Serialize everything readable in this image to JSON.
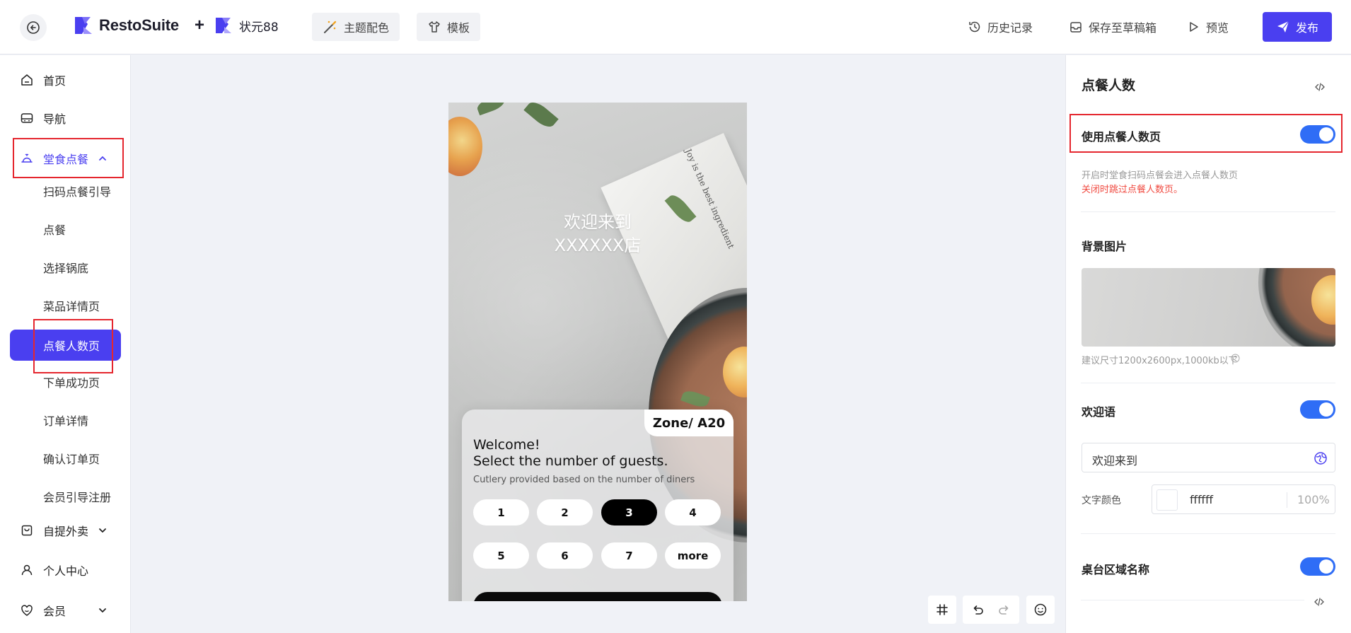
{
  "header": {
    "back_icon": "back-arrow-icon",
    "brand_name": "RestoSuite",
    "plus": "+",
    "store_name": "状元88",
    "theme_btn": "主题配色",
    "template_btn": "模板",
    "history": "历史记录",
    "save_draft": "保存至草稿箱",
    "preview": "预览",
    "publish": "发布",
    "accent_color": "#4a3ff0"
  },
  "sidebar": {
    "items": [
      {
        "label": "首页",
        "icon": "home-icon"
      },
      {
        "label": "导航",
        "icon": "navigation-icon"
      },
      {
        "label": "堂食点餐",
        "icon": "dine-in-icon",
        "expanded": true
      },
      {
        "label": "自提外卖",
        "icon": "takeaway-icon"
      },
      {
        "label": "个人中心",
        "icon": "user-icon"
      },
      {
        "label": "会员",
        "icon": "member-icon"
      }
    ],
    "sub_items": [
      "扫码点餐引导",
      "点餐",
      "选择锅底",
      "菜品详情页",
      "点餐人数页",
      "下单成功页",
      "订单详情",
      "确认订单页",
      "会员引导注册"
    ],
    "active_sub": "点餐人数页"
  },
  "preview": {
    "welcome_line1": "欢迎来到",
    "welcome_line2": "XXXXXX店",
    "napkin_text": "Joy is the best ingredient",
    "zone": "Zone/ A20",
    "title1": "Welcome!",
    "title2": "Select the number of guests.",
    "subtitle": "Cutlery provided based on the number of diners",
    "guest_options": [
      "1",
      "2",
      "3",
      "4",
      "5",
      "6",
      "7",
      "more"
    ],
    "selected_guest": "3"
  },
  "toolbar": {
    "grid_icon": "grid-hash-icon",
    "undo_icon": "undo-icon",
    "redo_icon": "redo-icon",
    "emoji_icon": "smiley-icon"
  },
  "panel": {
    "title": "点餐人数",
    "use_page_label": "使用点餐人数页",
    "use_page_on": true,
    "hint_on": "开启时堂食扫码点餐会进入点餐人数页",
    "hint_off": "关闭时跳过点餐人数页。",
    "bg_label": "背景图片",
    "bg_hint": "建议尺寸1200x2600px,1000kb以下",
    "welcome_label": "欢迎语",
    "welcome_on": true,
    "welcome_value": "欢迎来到",
    "text_color_label": "文字颜色",
    "text_color_hex": "ffffff",
    "text_color_opacity": "100%",
    "zone_label": "桌台区域名称",
    "zone_on": true,
    "toggle_color": "#2f6df6"
  }
}
